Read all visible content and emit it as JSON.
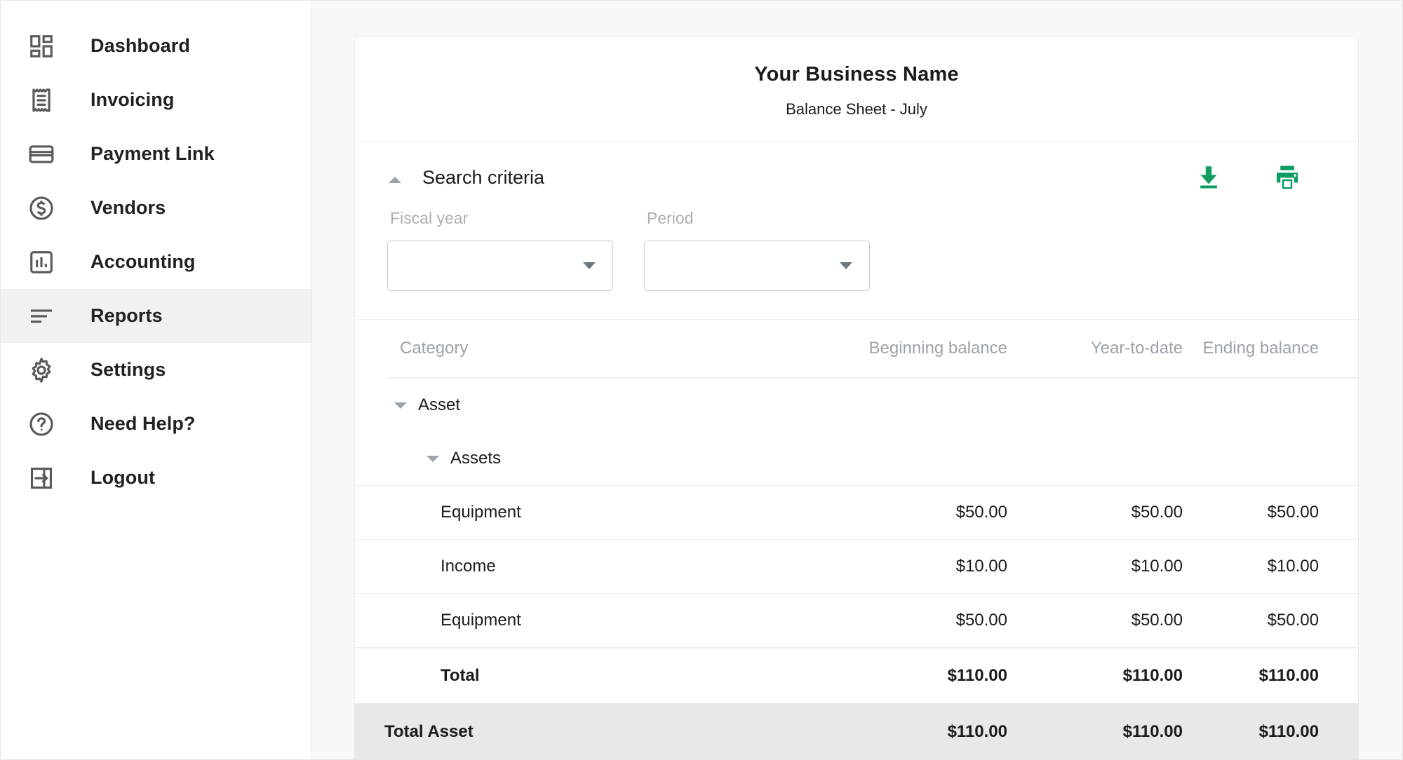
{
  "sidebar": {
    "items": [
      {
        "label": "Dashboard",
        "icon": "dashboard-grid-icon",
        "active": false
      },
      {
        "label": "Invoicing",
        "icon": "receipt-icon",
        "active": false
      },
      {
        "label": "Payment Link",
        "icon": "credit-card-icon",
        "active": false
      },
      {
        "label": "Vendors",
        "icon": "dollar-circle-icon",
        "active": false
      },
      {
        "label": "Accounting",
        "icon": "bar-chart-box-icon",
        "active": false
      },
      {
        "label": "Reports",
        "icon": "report-lines-icon",
        "active": true
      },
      {
        "label": "Settings",
        "icon": "gear-icon",
        "active": false
      },
      {
        "label": "Need Help?",
        "icon": "question-circle-icon",
        "active": false
      },
      {
        "label": "Logout",
        "icon": "logout-arrow-icon",
        "active": false
      }
    ]
  },
  "report": {
    "business_name": "Your Business Name",
    "subtitle": "Balance Sheet - July"
  },
  "criteria": {
    "title": "Search criteria",
    "collapse_icon": "triangle-up-icon",
    "download_icon": "download-icon",
    "print_icon": "print-icon",
    "accent_color": "#0f9d63",
    "fields": [
      {
        "label": "Fiscal year",
        "value": "",
        "placeholder": ""
      },
      {
        "label": "Period",
        "value": "",
        "placeholder": ""
      }
    ]
  },
  "table": {
    "columns": [
      "Category",
      "Beginning balance",
      "Year-to-date",
      "Ending balance"
    ],
    "groups": [
      {
        "label": "Asset",
        "level": 1,
        "expanded": true
      },
      {
        "label": "Assets",
        "level": 2,
        "expanded": true
      }
    ],
    "rows": [
      {
        "category": "Equipment",
        "beginning": "$50.00",
        "ytd": "$50.00",
        "ending": "$50.00"
      },
      {
        "category": "Income",
        "beginning": "$10.00",
        "ytd": "$10.00",
        "ending": "$10.00"
      },
      {
        "category": "Equipment",
        "beginning": "$50.00",
        "ytd": "$50.00",
        "ending": "$50.00"
      }
    ],
    "subtotal": {
      "category": "Total",
      "beginning": "$110.00",
      "ytd": "$110.00",
      "ending": "$110.00"
    },
    "grand_total": {
      "category": "Total Asset",
      "beginning": "$110.00",
      "ytd": "$110.00",
      "ending": "$110.00"
    }
  }
}
